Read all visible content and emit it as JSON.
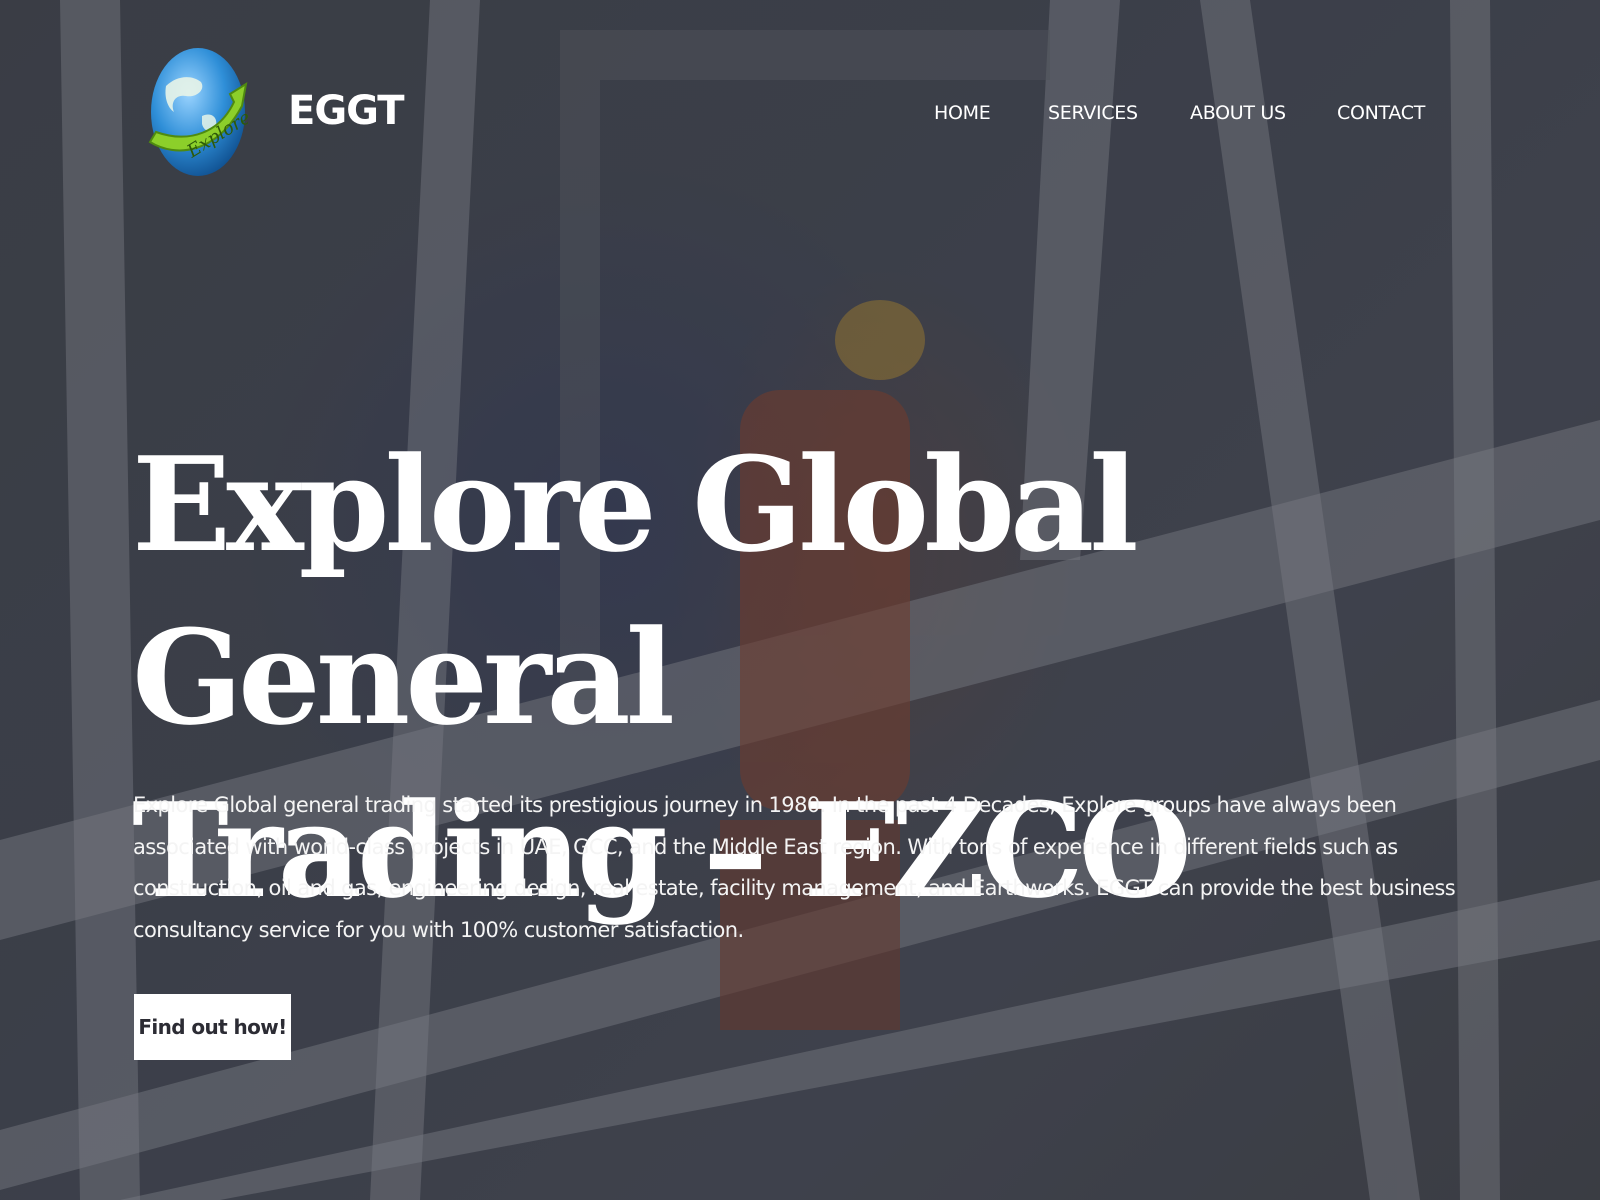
{
  "header": {
    "brand": "EGGT",
    "logo_text": "Explore",
    "logo_icon": "globe-arrow-logo"
  },
  "nav": {
    "items": [
      {
        "label": "HOME"
      },
      {
        "label": "SERVICES"
      },
      {
        "label": "ABOUT US"
      },
      {
        "label": "CONTACT"
      }
    ]
  },
  "hero": {
    "title_line1": "Explore Global General",
    "title_line2": "Trading – FZCO",
    "description": "Explore Global general trading started its prestigious journey in 1980. In the past 4 Decades, Explore groups have always been associated with world-class projects in UAE, GCC, and the Middle East region. With tons of experience in different fields such as construction, oil and gas, engineering design, real estate, facility management, and Earthworks. EGGT can provide the best business consultancy service for you with 100% customer satisfaction.",
    "cta_label": "Find out how!"
  },
  "colors": {
    "text": "#ffffff",
    "button_bg": "#ffffff",
    "button_text": "#2c2c34",
    "overlay": "#3d4049",
    "logo_globe": "#2f8fd8",
    "logo_arrow": "#8ccf2a"
  }
}
